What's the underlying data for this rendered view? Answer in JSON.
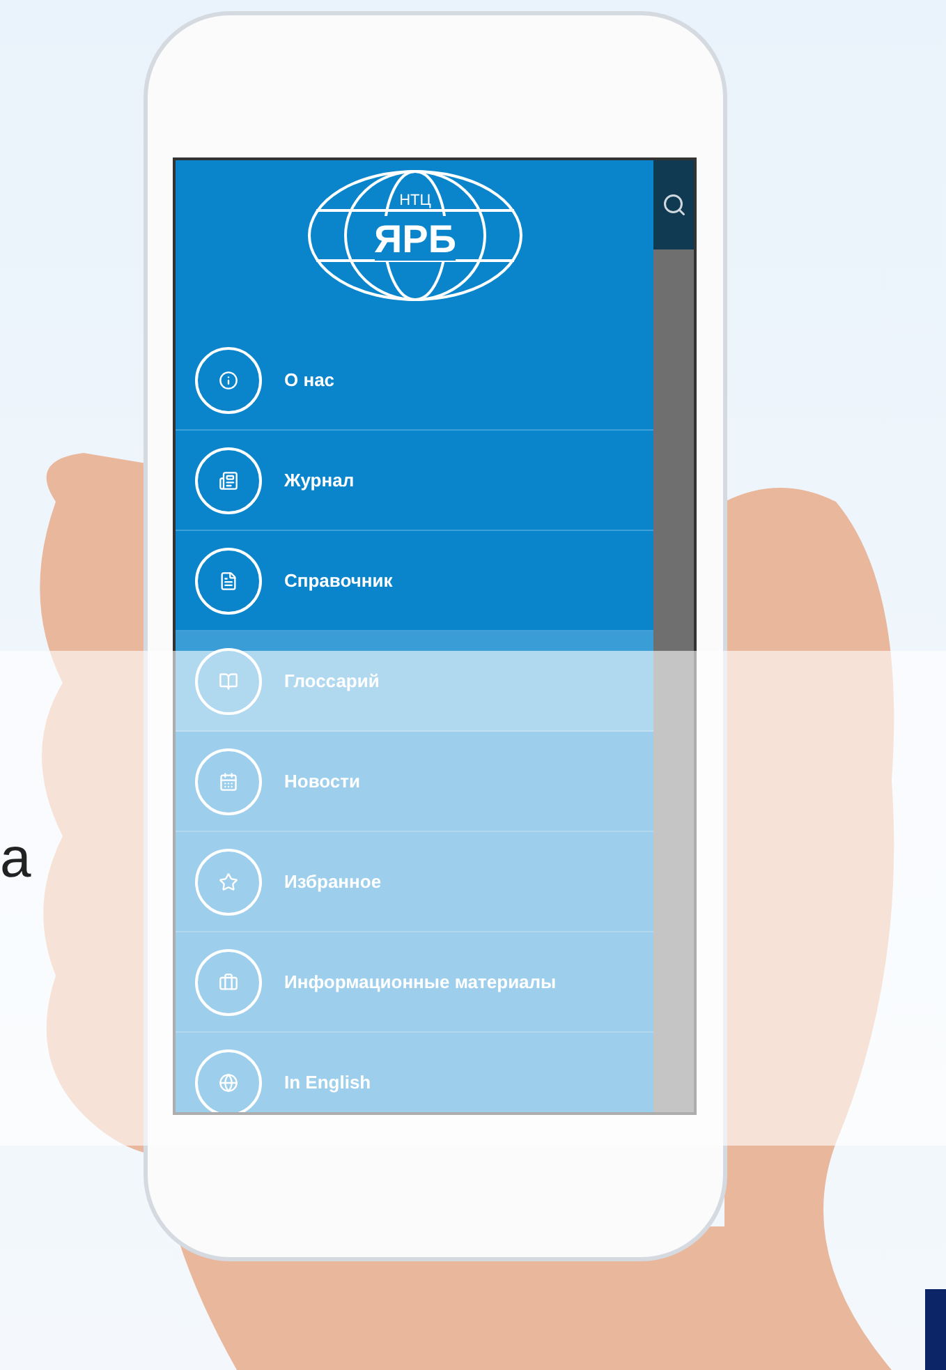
{
  "side_text": "а",
  "logo": {
    "top": "НТЦ",
    "main": "ЯРБ"
  },
  "menu": [
    {
      "label": "О нас",
      "selected": false
    },
    {
      "label": "Журнал",
      "selected": false
    },
    {
      "label": "Справочник",
      "selected": false
    },
    {
      "label": "Глоссарий",
      "selected": true
    },
    {
      "label": "Новости",
      "selected": false
    },
    {
      "label": "Избранное",
      "selected": false
    },
    {
      "label": "Информационные материалы",
      "selected": false
    },
    {
      "label": "In English",
      "selected": false
    }
  ]
}
